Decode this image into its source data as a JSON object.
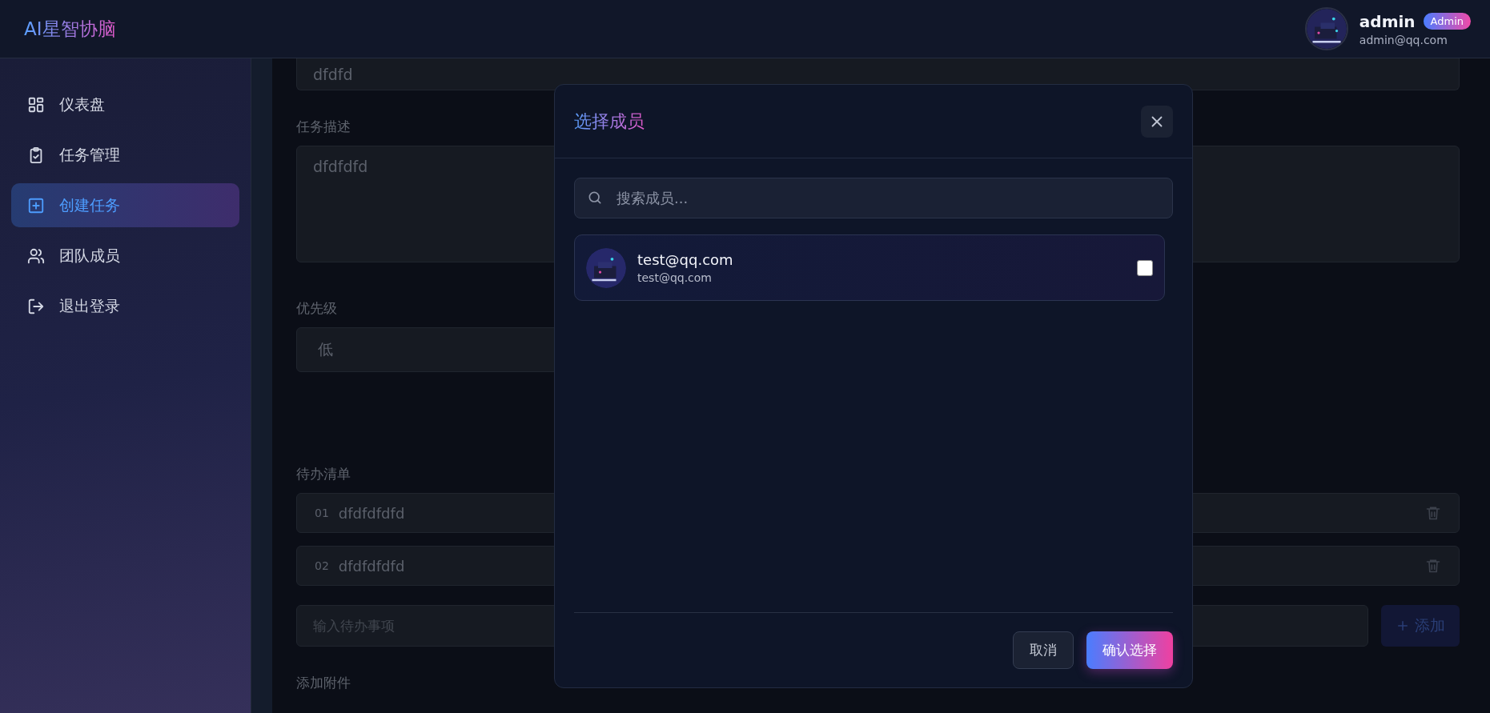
{
  "app": {
    "logo_prefix": "AI",
    "logo": "星智协脑"
  },
  "user": {
    "name": "admin",
    "role": "Admin",
    "email": "admin@qq.com"
  },
  "sidebar": {
    "items": [
      {
        "label": "仪表盘",
        "kind": "grid",
        "selected": false
      },
      {
        "label": "任务管理",
        "kind": "clipboard",
        "selected": false
      },
      {
        "label": "创建任务",
        "kind": "plus",
        "selected": true
      },
      {
        "label": "团队成员",
        "kind": "users",
        "selected": false
      },
      {
        "label": "退出登录",
        "kind": "logout",
        "selected": false
      }
    ]
  },
  "form": {
    "title_value": "dfdfd",
    "description_label": "任务描述",
    "description_value": "dfdfdfd",
    "priority_label": "优先级",
    "priority_value": "低",
    "todo_label": "待办清单",
    "todos": [
      {
        "index": "01",
        "text": "dfdfdfdfd"
      },
      {
        "index": "02",
        "text": "dfdfdfdfd"
      }
    ],
    "todo_placeholder": "输入待办事项",
    "add_button": "添加",
    "attachment_label": "添加附件"
  },
  "modal": {
    "title": "选择成员",
    "search_placeholder": "搜索成员...",
    "members": [
      {
        "name": "test@qq.com",
        "email": "test@qq.com",
        "checked": false
      }
    ],
    "cancel": "取消",
    "confirm": "确认选择"
  }
}
